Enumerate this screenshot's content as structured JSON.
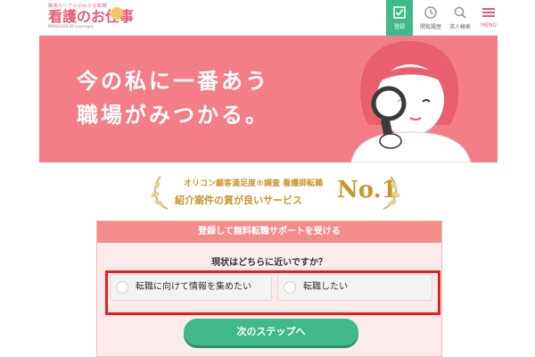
{
  "header": {
    "logo_tagline": "職場のリアルがわかる転職",
    "logo_title": "看護のお仕事",
    "logo_sub": "PRODUCED BY Leverages",
    "nav": {
      "register": "登録",
      "history": "閲覧履歴",
      "search": "求人検索",
      "menu": "MENU"
    }
  },
  "hero": {
    "line1": "今の私に一番あう",
    "line2": "職場がみつかる。"
  },
  "badge": {
    "line1": "オリコン顧客満足度®調査 看護師転職",
    "line2": "紹介案件の質が良いサービス",
    "rank": "No.1"
  },
  "form": {
    "header": "登録して無料転職サポートを受ける",
    "question": "現状はどちらに近いですか？",
    "options": [
      {
        "label": "転職に向けて情報を集めたい"
      },
      {
        "label": "転職したい"
      }
    ],
    "next_button": "次のステップへ"
  },
  "colors": {
    "brand_pink": "#f47e86",
    "accent_green": "#3fb98a",
    "gold": "#c8952e",
    "highlight_red": "#e81e1e"
  }
}
